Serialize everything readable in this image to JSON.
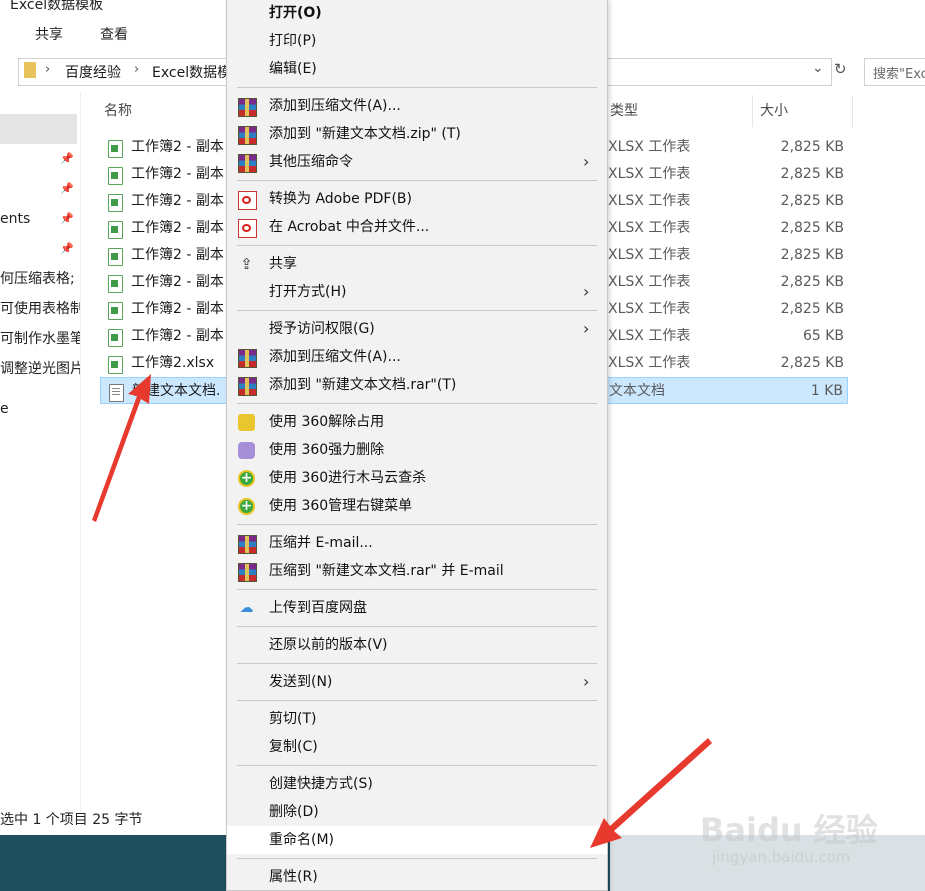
{
  "window": {
    "title": "Excel数据模板"
  },
  "ribbon": {
    "tabs": [
      "共享",
      "查看"
    ]
  },
  "address": {
    "parts": [
      "百度经验",
      "Excel数据模"
    ]
  },
  "search": {
    "placeholder": "搜索\"Exc"
  },
  "nav": {
    "items": [
      "ents",
      "何压缩表格;",
      "可使用表格制",
      "可制作水墨笔",
      "调整逆光图片",
      "e"
    ]
  },
  "columns": {
    "name": "名称",
    "type": "类型",
    "size": "大小"
  },
  "files": [
    {
      "name": "工作簿2 - 副本",
      "type": "XLSX 工作表",
      "size": "2,825 KB",
      "icon": "xlsx"
    },
    {
      "name": "工作簿2 - 副本",
      "type": "XLSX 工作表",
      "size": "2,825 KB",
      "icon": "xlsx"
    },
    {
      "name": "工作簿2 - 副本",
      "type": "XLSX 工作表",
      "size": "2,825 KB",
      "icon": "xlsx"
    },
    {
      "name": "工作簿2 - 副本",
      "type": "XLSX 工作表",
      "size": "2,825 KB",
      "icon": "xlsx"
    },
    {
      "name": "工作簿2 - 副本",
      "type": "XLSX 工作表",
      "size": "2,825 KB",
      "icon": "xlsx"
    },
    {
      "name": "工作簿2 - 副本",
      "type": "XLSX 工作表",
      "size": "2,825 KB",
      "icon": "xlsx"
    },
    {
      "name": "工作簿2 - 副本",
      "type": "XLSX 工作表",
      "size": "2,825 KB",
      "icon": "xlsx"
    },
    {
      "name": "工作簿2 - 副本",
      "type": "XLSX 工作表",
      "size": "65 KB",
      "icon": "xlsx"
    },
    {
      "name": "工作簿2.xlsx",
      "type": "XLSX 工作表",
      "size": "2,825 KB",
      "icon": "xlsx"
    },
    {
      "name": "新建文本文档.",
      "type": "文本文档",
      "size": "1 KB",
      "icon": "txt"
    }
  ],
  "status": {
    "text": "选中 1 个项目  25 字节"
  },
  "context_menu": {
    "items": [
      {
        "label": "打开(O)",
        "icon": "",
        "bold": true
      },
      {
        "label": "打印(P)",
        "icon": ""
      },
      {
        "label": "编辑(E)",
        "icon": ""
      },
      {
        "sep": true
      },
      {
        "label": "添加到压缩文件(A)...",
        "icon": "rar-icon"
      },
      {
        "label": "添加到 \"新建文本文档.zip\" (T)",
        "icon": "rar-icon"
      },
      {
        "label": "其他压缩命令",
        "icon": "rar-icon",
        "submenu": true
      },
      {
        "sep": true
      },
      {
        "label": "转换为 Adobe PDF(B)",
        "icon": "pdf-icon"
      },
      {
        "label": "在 Acrobat 中合并文件...",
        "icon": "pdf-icon"
      },
      {
        "sep": true
      },
      {
        "label": "共享",
        "icon": "share-icon"
      },
      {
        "label": "打开方式(H)",
        "icon": "",
        "submenu": true
      },
      {
        "sep": true
      },
      {
        "label": "授予访问权限(G)",
        "icon": "",
        "submenu": true
      },
      {
        "label": "添加到压缩文件(A)...",
        "icon": "winrar-icon"
      },
      {
        "label": "添加到 \"新建文本文档.rar\"(T)",
        "icon": "winrar-icon"
      },
      {
        "sep": true
      },
      {
        "label": "使用 360解除占用",
        "icon": "360-unlock-icon"
      },
      {
        "label": "使用 360强力删除",
        "icon": "360-delete-icon"
      },
      {
        "label": "使用 360进行木马云查杀",
        "icon": "360-scan-icon"
      },
      {
        "label": "使用 360管理右键菜单",
        "icon": "360-menu-icon"
      },
      {
        "sep": true
      },
      {
        "label": "压缩并 E-mail...",
        "icon": "winrar-icon"
      },
      {
        "label": "压缩到 \"新建文本文档.rar\" 并 E-mail",
        "icon": "winrar-icon"
      },
      {
        "sep": true
      },
      {
        "label": "上传到百度网盘",
        "icon": "baidu-cloud-icon"
      },
      {
        "sep": true
      },
      {
        "label": "还原以前的版本(V)",
        "icon": ""
      },
      {
        "sep": true
      },
      {
        "label": "发送到(N)",
        "icon": "",
        "submenu": true
      },
      {
        "sep": true
      },
      {
        "label": "剪切(T)",
        "icon": ""
      },
      {
        "label": "复制(C)",
        "icon": ""
      },
      {
        "sep": true
      },
      {
        "label": "创建快捷方式(S)",
        "icon": ""
      },
      {
        "label": "删除(D)",
        "icon": ""
      },
      {
        "label": "重命名(M)",
        "icon": "",
        "highlighted": true
      },
      {
        "sep": true
      },
      {
        "label": "属性(R)",
        "icon": ""
      }
    ]
  },
  "watermark": {
    "brand": "Baidu 经验",
    "url": "jingyan.baidu.com"
  },
  "colors": {
    "arrow": "#e8392f",
    "selection": "#cce8ff",
    "taskbar": "#1f4f5e"
  }
}
